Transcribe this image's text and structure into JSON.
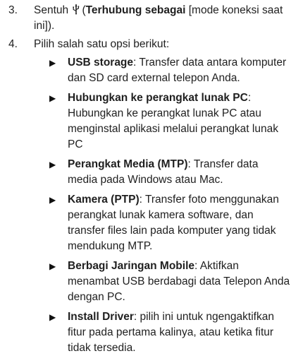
{
  "steps": [
    {
      "number": "3.",
      "prefix": "Sentuh ",
      "open_paren": "(",
      "bold_text": "Terhubung sebagai",
      "suffix": " [mode koneksi saat ini])."
    },
    {
      "number": "4.",
      "text": "Pilih salah satu opsi berikut:"
    }
  ],
  "icons": {
    "usb": "usb-icon",
    "bullet": "▶"
  },
  "options": [
    {
      "title": "USB storage",
      "description": ": Transfer data antara komputer dan SD card external telepon Anda."
    },
    {
      "title": "Hubungkan ke perangkat lunak PC",
      "description": ": Hubungkan ke perangkat lunak PC atau menginstal aplikasi melalui perangkat lunak PC"
    },
    {
      "title": "Perangkat Media (MTP)",
      "description": ": Transfer  data media pada Windows atau Mac."
    },
    {
      "title": "Kamera (PTP)",
      "description": ": Transfer foto menggunakan perangkat lunak kamera software, dan transfer files lain pada komputer yang tidak mendukung MTP."
    },
    {
      "title": "Berbagi Jaringan Mobile",
      "description": ": Aktifkan menambat USB berdabagi data  Telepon Anda dengan PC."
    },
    {
      "title": "Install Driver",
      "description": ": pilih ini untuk ngengaktifkan fitur pada pertama kalinya, atau ketika fitur tidak tersedia."
    }
  ]
}
